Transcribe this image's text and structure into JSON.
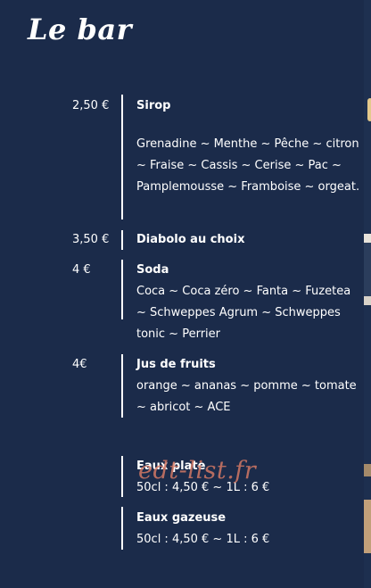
{
  "page": {
    "title": "Le bar"
  },
  "sections": {
    "sirop": {
      "price": "2,50 €",
      "name": "Sirop",
      "desc": "Grenadine ~ Menthe ~ Pêche ~ citron ~ Fraise ~ Cassis  ~ Cerise ~ Pac ~ Pamplemousse ~ Framboise ~ orgeat."
    },
    "diabolo": {
      "price": "3,50 €",
      "name": "Diabolo au choix"
    },
    "soda": {
      "price": "4 €",
      "name": "Soda",
      "desc": "Coca ~ Coca zéro ~ Fanta ~ Fuzetea ~ Schweppes Agrum ~  Schweppes tonic  ~ Perrier"
    },
    "jus": {
      "price": "4€",
      "name": "Jus de fruits",
      "desc": "orange ~ ananas ~ pomme ~ tomate ~ abricot ~ ACE"
    },
    "eaux_plate": {
      "name": "Eaux plate",
      "desc": "50cl : 4,50 € ~ 1L : 6 €"
    },
    "eaux_gazeuse": {
      "name": "Eaux gazeuse",
      "desc": "50cl : 4,50 € ~ 1L : 6 €"
    }
  },
  "watermark": {
    "text": "edt-list.fr"
  }
}
